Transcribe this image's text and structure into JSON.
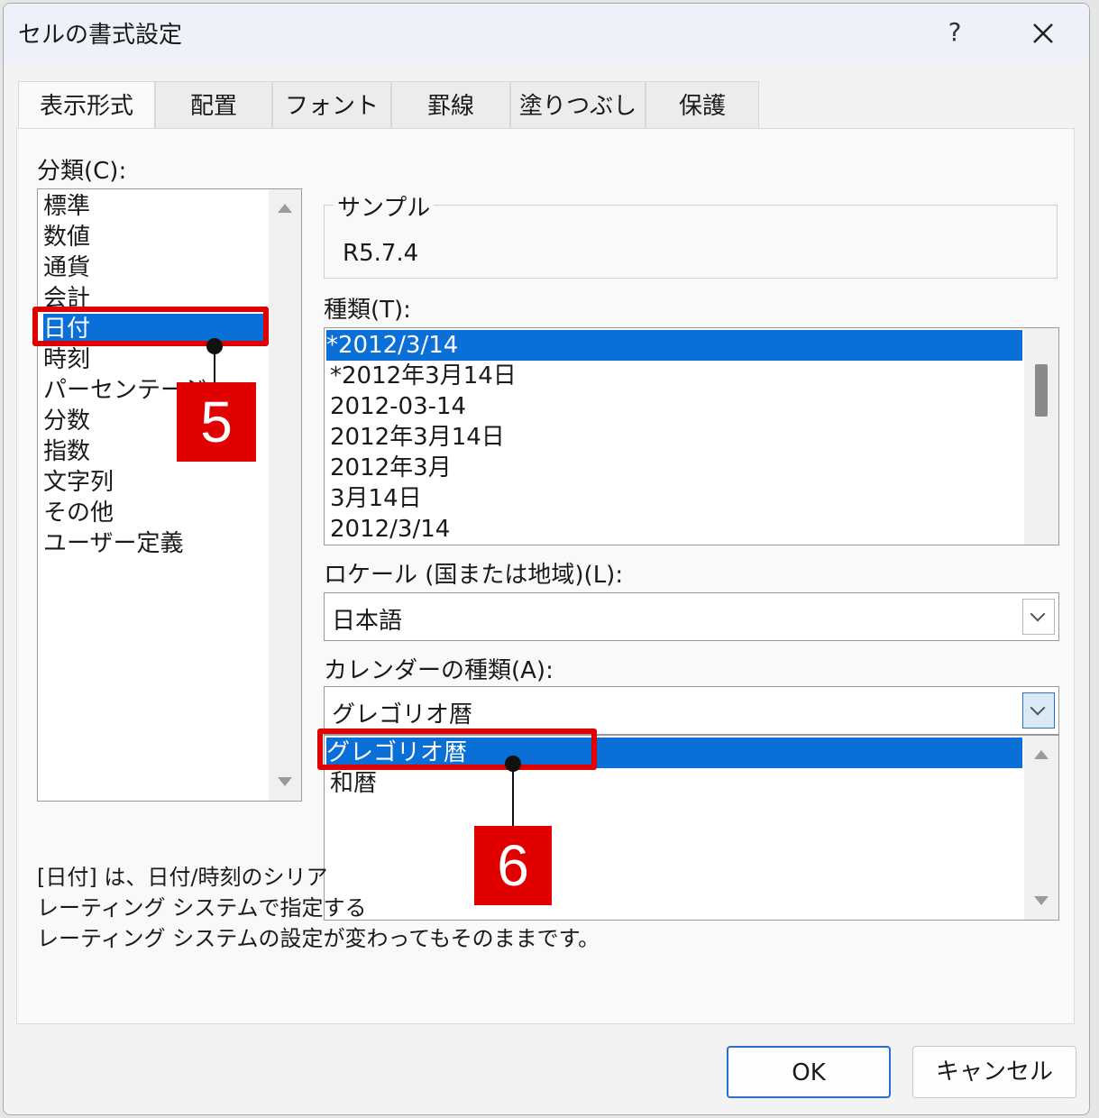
{
  "dialog": {
    "title": "セルの書式設定",
    "help_label": "?",
    "tabs": [
      "表示形式",
      "配置",
      "フォント",
      "罫線",
      "塗りつぶし",
      "保護"
    ]
  },
  "category": {
    "label": "分類(C):",
    "items": [
      "標準",
      "数値",
      "通貨",
      "会計",
      "日付",
      "時刻",
      "パーセンテージ",
      "分数",
      "指数",
      "文字列",
      "その他",
      "ユーザー定義"
    ],
    "selected": "日付"
  },
  "sample": {
    "label": "サンプル",
    "value": "R5.7.4"
  },
  "type": {
    "label": "種類(T):",
    "items": [
      "*2012/3/14",
      "*2012年3月14日",
      "2012-03-14",
      "2012年3月14日",
      "2012年3月",
      "3月14日",
      "2012/3/14"
    ],
    "selected": "*2012/3/14"
  },
  "locale": {
    "label": "ロケール (国または地域)(L):",
    "value": "日本語"
  },
  "calendar": {
    "label": "カレンダーの種類(A):",
    "value": "グレゴリオ暦",
    "options": [
      "グレゴリオ暦",
      "和暦"
    ]
  },
  "description": {
    "line1": "[日付] は、日付/時刻のシリア",
    "line2": "レーティング システムで指定する",
    "line3": "レーティング システムの設定が変わってもそのままです。"
  },
  "buttons": {
    "ok": "OK",
    "cancel": "キャンセル"
  },
  "annotations": {
    "step5": "5",
    "step6": "6",
    "highlight_color": "#e00000"
  }
}
